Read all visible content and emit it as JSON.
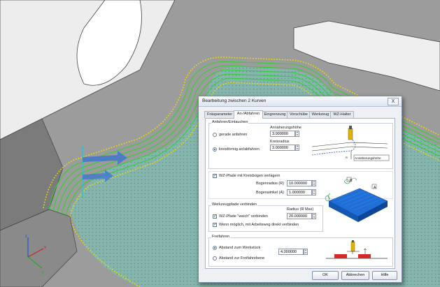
{
  "dialog": {
    "title": "Bearbeitung zwischen 2 Kurven",
    "close_label": "X"
  },
  "tabs": [
    {
      "label": "Fräsparameter"
    },
    {
      "label": "An-/Abfahren"
    },
    {
      "label": "Eingrenzung"
    },
    {
      "label": "Vorschübe"
    },
    {
      "label": "Werkzeug"
    },
    {
      "label": "WZ-Halter"
    }
  ],
  "approach": {
    "group_label": "Anfahren/Eintauchen",
    "option_straight": "gerade anfahren",
    "option_circular": "kreisförmig an/abfahren",
    "selected": "kreisförmig an/abfahren",
    "approach_height_label": "Annäherungshöhe",
    "approach_height_value": "3.000000",
    "circle_radius_label": "Kreisradius",
    "circle_radius_value": "3.000000",
    "diagram_caption": "Annäherungshöhe"
  },
  "arc": {
    "checkbox_label": "WZ-Pfade mit Kreisbogen verlagern",
    "checked": true,
    "radius_label": "Bogenradius (R)",
    "radius_value": "10.000000",
    "angle_label": "Bogenwinkel (A)",
    "angle_value": "1.000000",
    "diagram_r_label": "R",
    "diagram_a_label": "A"
  },
  "connect": {
    "group_label": "Werkzeugpfade verbinden",
    "radius_max_label": "Radius (R Max)",
    "soft_label": "WZ-Pfade \"weich\" verbinden",
    "soft_checked": true,
    "soft_value": "20.000000",
    "direct_label": "Wenn möglich, mit  Arbeitsweg direkt verbinden",
    "direct_checked": true
  },
  "retract": {
    "group_label": "Freifahren",
    "option_workpiece": "Abstand zum Werkstück",
    "option_plane": "Abstand zur Freifahrebene",
    "selected": "Abstand zum Werkstück",
    "value": "4.000000"
  },
  "buttons": {
    "ok": "OK",
    "cancel": "Abbrechen",
    "help": "Hilfe"
  },
  "colors": {
    "toolpath_green": "#2fd12f",
    "boundary_yellow": "#e8e000",
    "floor_teal": "#7fb0a8",
    "part_gray": "#9a9a9a",
    "tool_blue": "#3a6fd8",
    "diagram_blue": "#1f6fd6"
  }
}
